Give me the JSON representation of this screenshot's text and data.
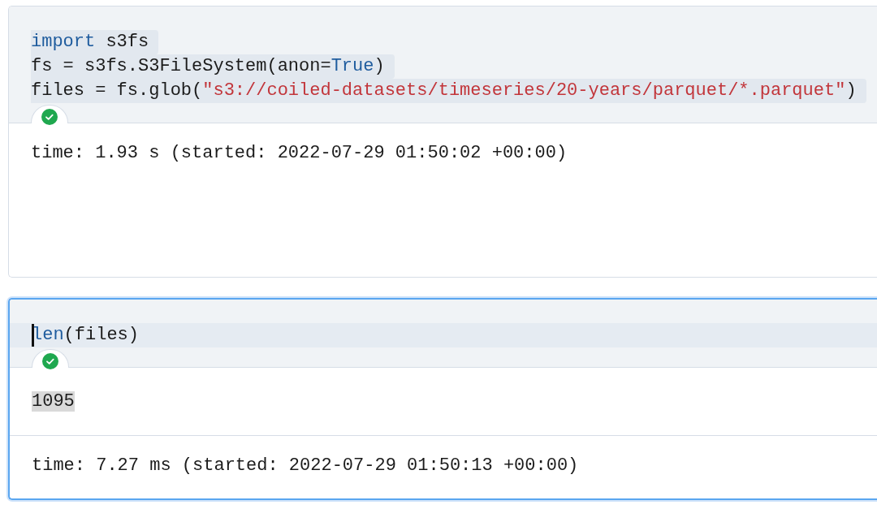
{
  "cells": [
    {
      "selected": false,
      "succeeded": true,
      "code": [
        {
          "selected": true,
          "tokens": [
            {
              "kind": "keyword",
              "text": "import"
            },
            {
              "kind": "plain",
              "text": " s3fs"
            }
          ]
        },
        {
          "selected": true,
          "tokens": [
            {
              "kind": "plain",
              "text": "fs = s3fs.S3FileSystem(anon="
            },
            {
              "kind": "keyword",
              "text": "True"
            },
            {
              "kind": "plain",
              "text": ")"
            }
          ]
        },
        {
          "selected": true,
          "tokens": [
            {
              "kind": "plain",
              "text": "files = fs.glob("
            },
            {
              "kind": "string",
              "text": "\"s3://coiled-datasets/timeseries/20-years/parquet/*.parquet\""
            },
            {
              "kind": "plain",
              "text": ")"
            }
          ]
        }
      ],
      "outputs": [
        {
          "kind": "log",
          "text": "time: 1.93 s (started: 2022-07-29 01:50:02 +00:00)"
        }
      ]
    },
    {
      "selected": true,
      "succeeded": true,
      "code": [
        {
          "selected": false,
          "tokens": [
            {
              "kind": "keyword",
              "text": "len"
            },
            {
              "kind": "plain",
              "text": "(files)"
            }
          ]
        }
      ],
      "outputs": [
        {
          "kind": "result",
          "text": "1095"
        },
        {
          "kind": "log",
          "text": "time: 7.27 ms (started: 2022-07-29 01:50:13 +00:00)"
        }
      ]
    }
  ]
}
